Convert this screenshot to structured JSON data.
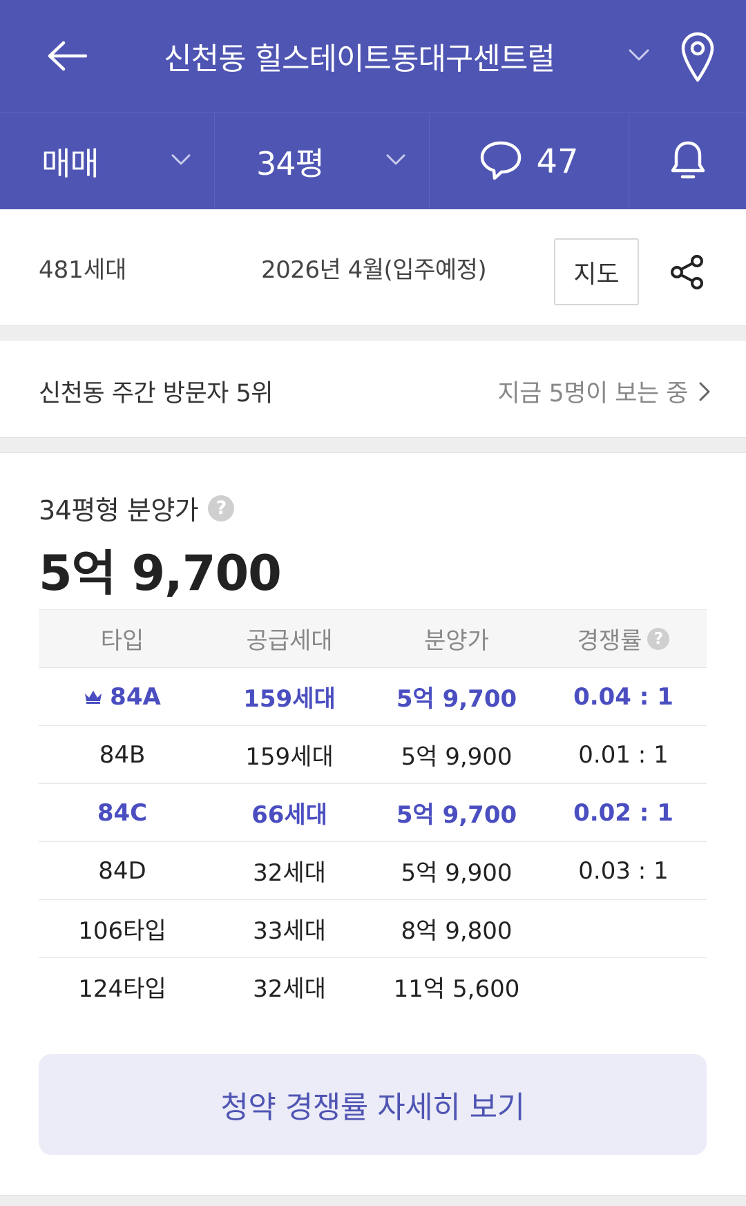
{
  "header": {
    "title": "신천동 힐스테이트동대구센트럴",
    "icons": {
      "back": "arrow-left-icon",
      "dropdown": "chevron-down-icon",
      "location": "map-pin-icon"
    }
  },
  "subbar": {
    "trade_type": "매매",
    "size": "34평",
    "comment_count": "47",
    "icons": {
      "comment": "speech-bubble-icon",
      "bell": "bell-icon"
    }
  },
  "info": {
    "households": "481세대",
    "move_in": "2026년 4월(입주예정)",
    "map_button": "지도",
    "share_icon": "share-icon"
  },
  "visitor": {
    "rank_text": "신천동 주간 방문자 5위",
    "viewers_text": "지금 5명이 보는 중"
  },
  "price": {
    "heading": "34평형 분양가",
    "help_glyph": "?",
    "value": "5억 9,700"
  },
  "table": {
    "headers": [
      "타입",
      "공급세대",
      "분양가",
      "경쟁률"
    ],
    "header_help_glyph": "?",
    "rows": [
      {
        "type": "84A",
        "supply": "159세대",
        "price": "5억 9,700",
        "ratio": "0.04 : 1",
        "highlight": true,
        "crown": true
      },
      {
        "type": "84B",
        "supply": "159세대",
        "price": "5억 9,900",
        "ratio": "0.01 : 1",
        "highlight": false,
        "crown": false
      },
      {
        "type": "84C",
        "supply": "66세대",
        "price": "5억 9,700",
        "ratio": "0.02 : 1",
        "highlight": true,
        "crown": false
      },
      {
        "type": "84D",
        "supply": "32세대",
        "price": "5억 9,900",
        "ratio": "0.03 : 1",
        "highlight": false,
        "crown": false
      },
      {
        "type": "106타입",
        "supply": "33세대",
        "price": "8억 9,800",
        "ratio": "",
        "highlight": false,
        "crown": false
      },
      {
        "type": "124타입",
        "supply": "32세대",
        "price": "11억 5,600",
        "ratio": "",
        "highlight": false,
        "crown": false
      }
    ]
  },
  "cta": {
    "label": "청약 경쟁률 자세히 보기"
  },
  "colors": {
    "brand": "#4f55b3",
    "highlight_text": "#4a4ec0",
    "cta_bg": "#ececf8"
  }
}
